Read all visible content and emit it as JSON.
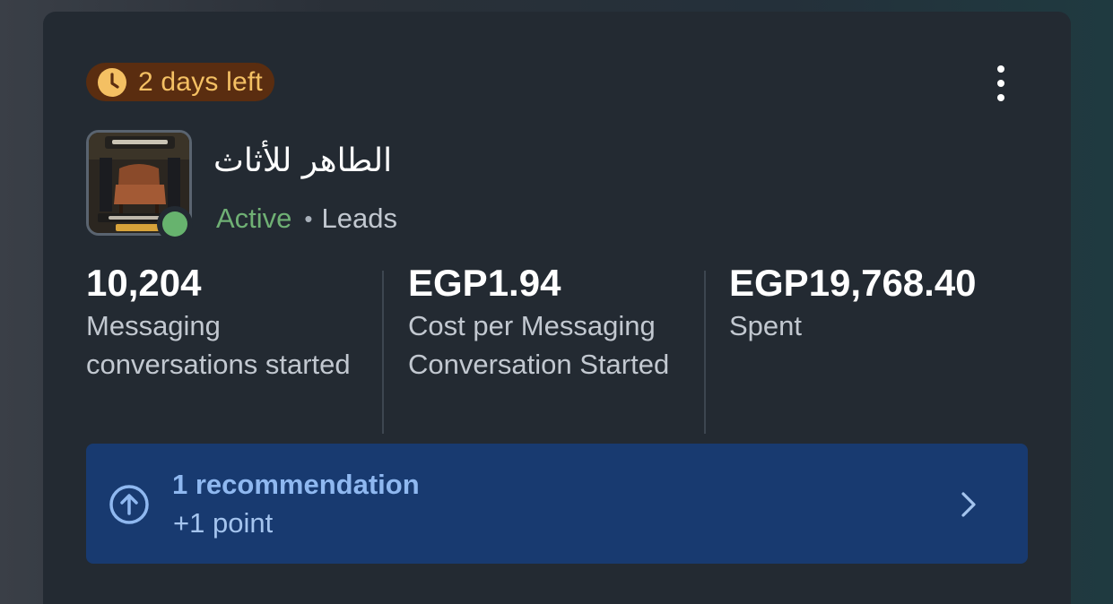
{
  "badge": {
    "text": "2 days left",
    "icon": "clock-icon",
    "bg_color": "#5a2d10",
    "text_color": "#f4c063"
  },
  "menu": {
    "icon": "more-vertical-icon"
  },
  "ad": {
    "name": "الطاهر للأثاث",
    "status": "Active",
    "separator": "•",
    "objective": "Leads",
    "status_color": "#67b36e"
  },
  "metrics": [
    {
      "value": "10,204",
      "label": "Messaging conversations started"
    },
    {
      "value": "EGP1.94",
      "label": "Cost per Messaging Conversation Started"
    },
    {
      "value": "EGP19,768.40",
      "label": "Spent"
    }
  ],
  "recommendation": {
    "title": "1 recommendation",
    "subtitle": "+1 point",
    "icon": "arrow-up-circle-icon",
    "chevron": "chevron-right-icon",
    "bg_color": "#183a70"
  }
}
